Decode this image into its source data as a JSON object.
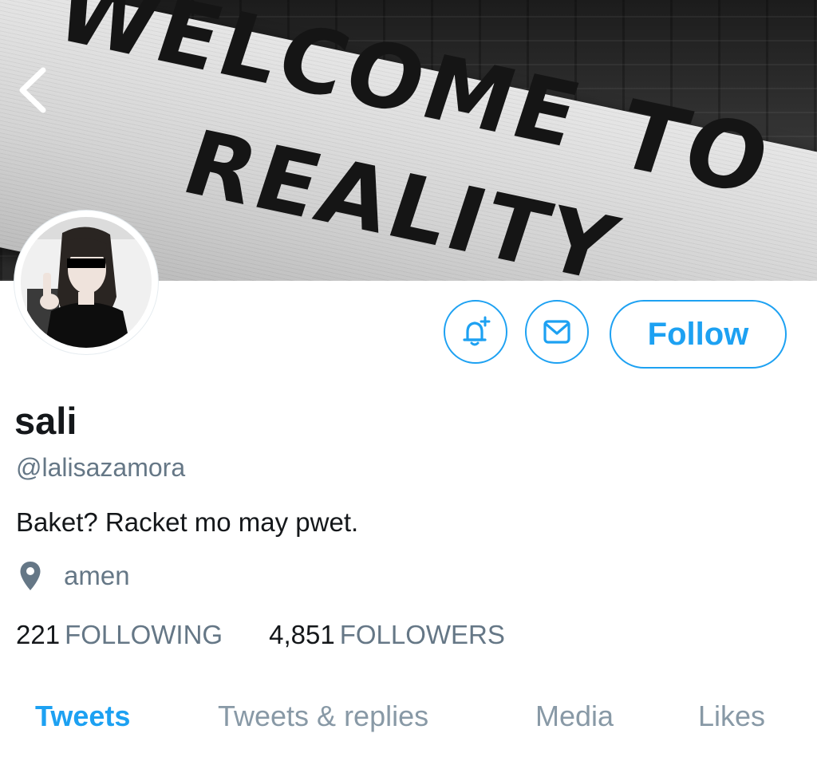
{
  "banner": {
    "sign_line1": "WELCOME",
    "sign_line2": "TO",
    "sign_line3": "REALITY"
  },
  "profile": {
    "display_name": "sali",
    "handle": "@lalisazamora",
    "bio": "Baket? Racket mo may pwet.",
    "location": "amen"
  },
  "actions": {
    "follow_label": "Follow"
  },
  "stats": {
    "following_count": "221",
    "following_label": "FOLLOWING",
    "followers_count": "4,851",
    "followers_label": "FOLLOWERS"
  },
  "tabs": [
    {
      "label": "Tweets",
      "active": true
    },
    {
      "label": "Tweets & replies",
      "active": false
    },
    {
      "label": "Media",
      "active": false
    },
    {
      "label": "Likes",
      "active": false
    }
  ],
  "colors": {
    "accent": "#1da1f2",
    "secondary_text": "#657786",
    "tab_inactive": "#8899a6",
    "primary_text": "#14171a"
  },
  "icons": {
    "back": "chevron-left-icon",
    "notify": "bell-plus-icon",
    "message": "envelope-icon",
    "location": "map-pin-icon"
  }
}
